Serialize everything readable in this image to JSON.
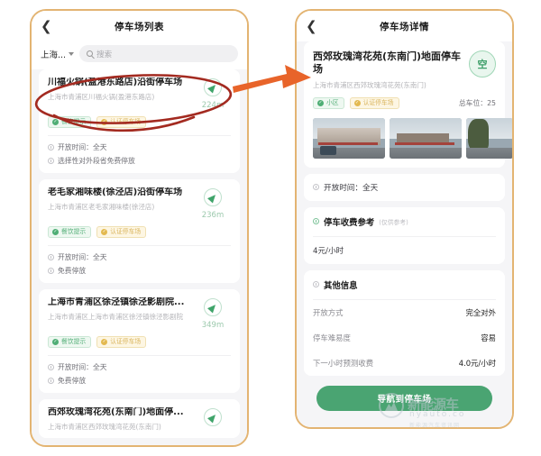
{
  "list_screen": {
    "nav": {
      "back_icon": "chevron-left-icon",
      "title": "停车场列表"
    },
    "search": {
      "city": "上海...",
      "placeholder": "搜索",
      "search_icon": "search-icon"
    },
    "cards": [
      {
        "title": "川福火锅(盈港东路店)沿街停车场",
        "address": "上海市青浦区川福火锅(盈港东路店)",
        "distance": "224m",
        "badges": [
          {
            "label": "餐饮提示",
            "style": "green"
          },
          {
            "label": "认证停车场",
            "style": "amber"
          }
        ],
        "meta": [
          "开放时间：全天",
          "选择性对外段省免费停放"
        ]
      },
      {
        "title": "老毛家湘味楼(徐泾店)沿街停车场",
        "address": "上海市青浦区老毛家湘味楼(徐泾店)",
        "distance": "236m",
        "badges": [
          {
            "label": "餐饮提示",
            "style": "green"
          },
          {
            "label": "认证停车场",
            "style": "amber"
          }
        ],
        "meta": [
          "开放时间：全天",
          "免费停放"
        ]
      },
      {
        "title": "上海市青浦区徐泾镇徐泾影剧院...",
        "address": "上海市青浦区上海市青浦区徐泾镇徐泾影剧院",
        "distance": "349m",
        "badges": [
          {
            "label": "餐饮提示",
            "style": "green"
          },
          {
            "label": "认证停车场",
            "style": "amber"
          }
        ],
        "meta": [
          "开放时间：全天",
          "免费停放"
        ]
      },
      {
        "title": "西郊玫瑰湾花苑(东南门)地面停...",
        "address": "上海市青浦区西郊玫瑰湾花苑(东南门)",
        "distance": "",
        "badges": [],
        "meta": []
      }
    ]
  },
  "detail_screen": {
    "nav": {
      "back_icon": "chevron-left-icon",
      "title": "停车场详情"
    },
    "title": "西郊玫瑰湾花苑(东南门)地面停车场",
    "address": "上海市青浦区西郊玫瑰湾花苑(东南门)",
    "status_badge": "空",
    "badges": [
      {
        "label": "小区",
        "style": "green"
      },
      {
        "label": "认证停车场",
        "style": "amber"
      }
    ],
    "total_spots": "总车位：25",
    "open_time": "开放时间：全天",
    "fee_section": {
      "title": "停车收费参考",
      "note": "(仅供参考)",
      "value": "4元/小时"
    },
    "other_section": {
      "title": "其他信息"
    },
    "info_rows": [
      {
        "key": "开放方式",
        "value": "完全对外"
      },
      {
        "key": "停车难易度",
        "value": "容易"
      },
      {
        "key": "下一小时预测收费",
        "value": "4.0元/小时"
      }
    ],
    "cta_label": "导航到停车场"
  },
  "watermark": {
    "brand": "新能源车",
    "domain": "nyauto.co",
    "sub": "新能源汽车资讯网"
  },
  "colors": {
    "frame": "#e3b472",
    "accent_green": "#4aa472",
    "badge_green": "#57b07a",
    "badge_amber": "#d9b45c",
    "annotation_red": "#a32a20",
    "annotation_arrow": "#e8642a"
  }
}
